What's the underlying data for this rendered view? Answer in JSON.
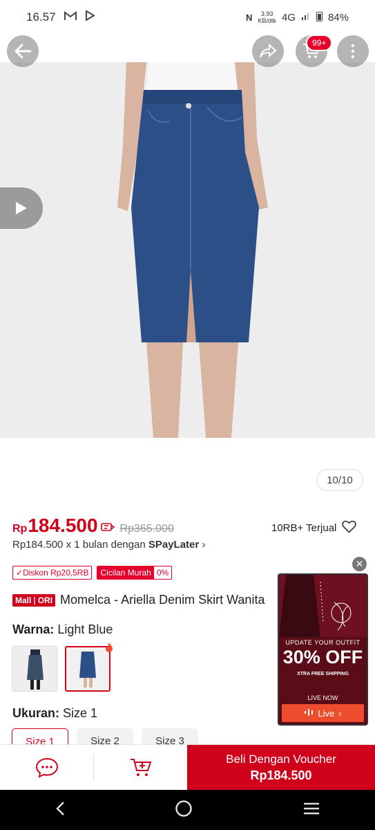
{
  "status": {
    "time": "16.57",
    "speed": "3,93",
    "speed_unit": "KB/dtk",
    "network": "4G",
    "battery": "84%"
  },
  "header": {
    "cart_badge": "99+"
  },
  "gallery": {
    "counter": "10/10"
  },
  "price": {
    "currency": "Rp",
    "value": "184.500",
    "original": "Rp365.000",
    "sold": "10RB+ Terjual"
  },
  "installment": {
    "text": "Rp184.500 x 1 bulan dengan",
    "provider": "SPayLater"
  },
  "tags": {
    "discount": "Diskon Rp20,5RB",
    "cicilan": "Cicilan Murah",
    "zero": "0%"
  },
  "product": {
    "badge_mall": "Mall",
    "badge_ori": "ORI",
    "title": "Momelca - Ariella Denim Skirt Wanita"
  },
  "variant": {
    "color_label": "Warna:",
    "color_value": "Light Blue",
    "size_label": "Ukuran:",
    "size_value": "Size 1",
    "sizes": [
      "Size 1",
      "Size 2",
      "Size 3"
    ]
  },
  "live_ad": {
    "headline": "UPDATE YOUR OUTFIT",
    "offer": "30% OFF",
    "shipping": "XTRA FREE SHIPPING",
    "live_now": "LIVE NOW",
    "button": "Live"
  },
  "actions": {
    "buy_label": "Beli Dengan Voucher",
    "buy_price": "Rp184.500"
  },
  "colors": {
    "brand_red": "#d0011b",
    "denim": "#2b4f86"
  }
}
